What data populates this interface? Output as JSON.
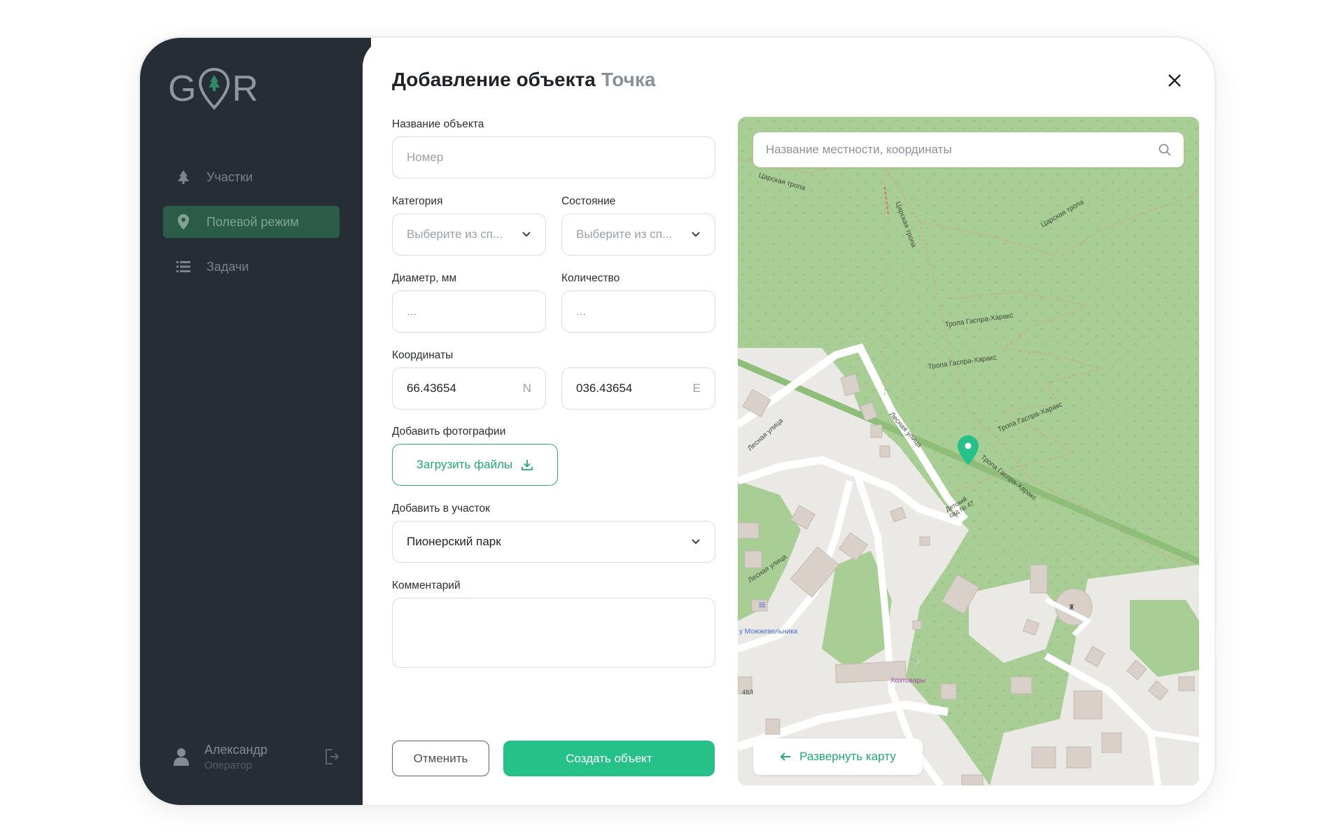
{
  "app": {
    "logo": {
      "left": "G",
      "right": "R"
    }
  },
  "sidebar": {
    "items": [
      {
        "label": "Участки",
        "icon": "tree-icon",
        "active": false
      },
      {
        "label": "Полевой режим",
        "icon": "location-pin-icon",
        "active": true
      },
      {
        "label": "Задачи",
        "icon": "list-icon",
        "active": false
      }
    ],
    "user": {
      "name": "Александр",
      "role": "Оператор"
    }
  },
  "header": {
    "title": "Добавление объекта",
    "subtitle": "Точка"
  },
  "form": {
    "name": {
      "label": "Название объекта",
      "placeholder": "Номер"
    },
    "category": {
      "label": "Категория",
      "placeholder": "Выберите из сп..."
    },
    "state": {
      "label": "Состояние",
      "placeholder": "Выберите из сп..."
    },
    "diameter": {
      "label": "Диаметр, мм",
      "placeholder": "..."
    },
    "quantity": {
      "label": "Количество",
      "placeholder": "..."
    },
    "coords": {
      "label": "Координаты",
      "lat": "66.43654",
      "lat_suffix": "N",
      "lon": "036.43654",
      "lon_suffix": "E"
    },
    "photos": {
      "label": "Добавить фотографии",
      "button": "Загрузить файлы"
    },
    "area": {
      "label": "Добавить в участок",
      "value": "Пионерский парк"
    },
    "comment": {
      "label": "Комментарий",
      "value": ""
    },
    "cancel": "Отменить",
    "create": "Создать объект"
  },
  "map": {
    "search_placeholder": "Название местности, координаты",
    "expand_label": "Развернуть карту",
    "labels": {
      "tsarskaya1": "Царская тропа",
      "tsarskaya2": "Царская тропа",
      "tsarskaya3": "Царская тропа",
      "gaspra1": "Тропа Гаспра-Харакс",
      "gaspra2": "Тропа Гаспра-Харакс",
      "gaspra3": "Тропа Гаспра-Харакс",
      "gaspra4": "Тропа Гаспра-Харакс",
      "lesnaya1": "Лесная улица",
      "lesnaya2": "Лесная улица",
      "lesnaya3": "Лесная улица",
      "kindergarten": "Детский сад № 47",
      "mozhzhevelnika": "у Можжевельника",
      "hoztovary": "Хозтовары",
      "house": "48Л"
    }
  },
  "colors": {
    "accent": "#26c188",
    "sidebar": "#262d35",
    "active_nav": "#2b5c4a"
  }
}
